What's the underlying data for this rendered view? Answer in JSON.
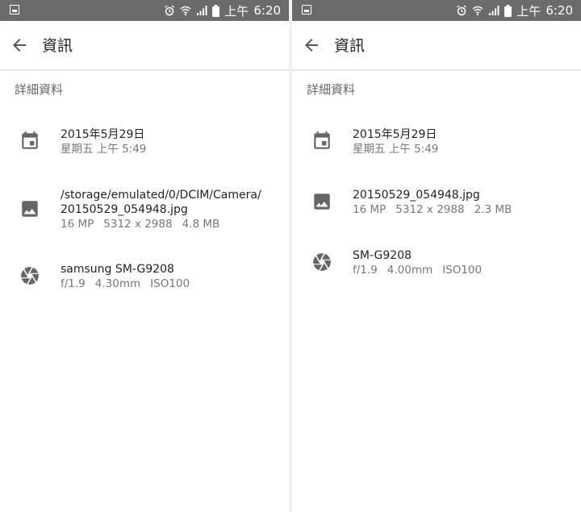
{
  "status_bar": {
    "time_prefix": "上午",
    "time": "6:20"
  },
  "panels": [
    {
      "appbar_title": "資訊",
      "section_title": "詳細資料",
      "date": {
        "line1": "2015年5月29日",
        "line2": "星期五 上午 5:49"
      },
      "file": {
        "path_line1": "/storage/emulated/0/DCIM/Camera/",
        "path_line2": "20150529_054948.jpg",
        "megapixels": "16 MP",
        "resolution": "5312 x 2988",
        "size": "4.8 MB"
      },
      "camera": {
        "model": "samsung SM-G9208",
        "aperture": "f/1.9",
        "focal": "4.30mm",
        "iso": "ISO100"
      }
    },
    {
      "appbar_title": "資訊",
      "section_title": "詳細資料",
      "date": {
        "line1": "2015年5月29日",
        "line2": "星期五 上午 5:49"
      },
      "file": {
        "name": "20150529_054948.jpg",
        "megapixels": "16 MP",
        "resolution": "5312 x 2988",
        "size": "2.3 MB"
      },
      "camera": {
        "model": "SM-G9208",
        "aperture": "f/1.9",
        "focal": "4.00mm",
        "iso": "ISO100"
      }
    }
  ],
  "icons": {
    "back": "arrow-back-icon",
    "date": "calendar-icon",
    "file": "image-icon",
    "camera": "aperture-icon",
    "status": [
      "gallery-notification-icon",
      "alarm-icon",
      "wifi-icon",
      "signal-icon",
      "battery-icon"
    ]
  }
}
